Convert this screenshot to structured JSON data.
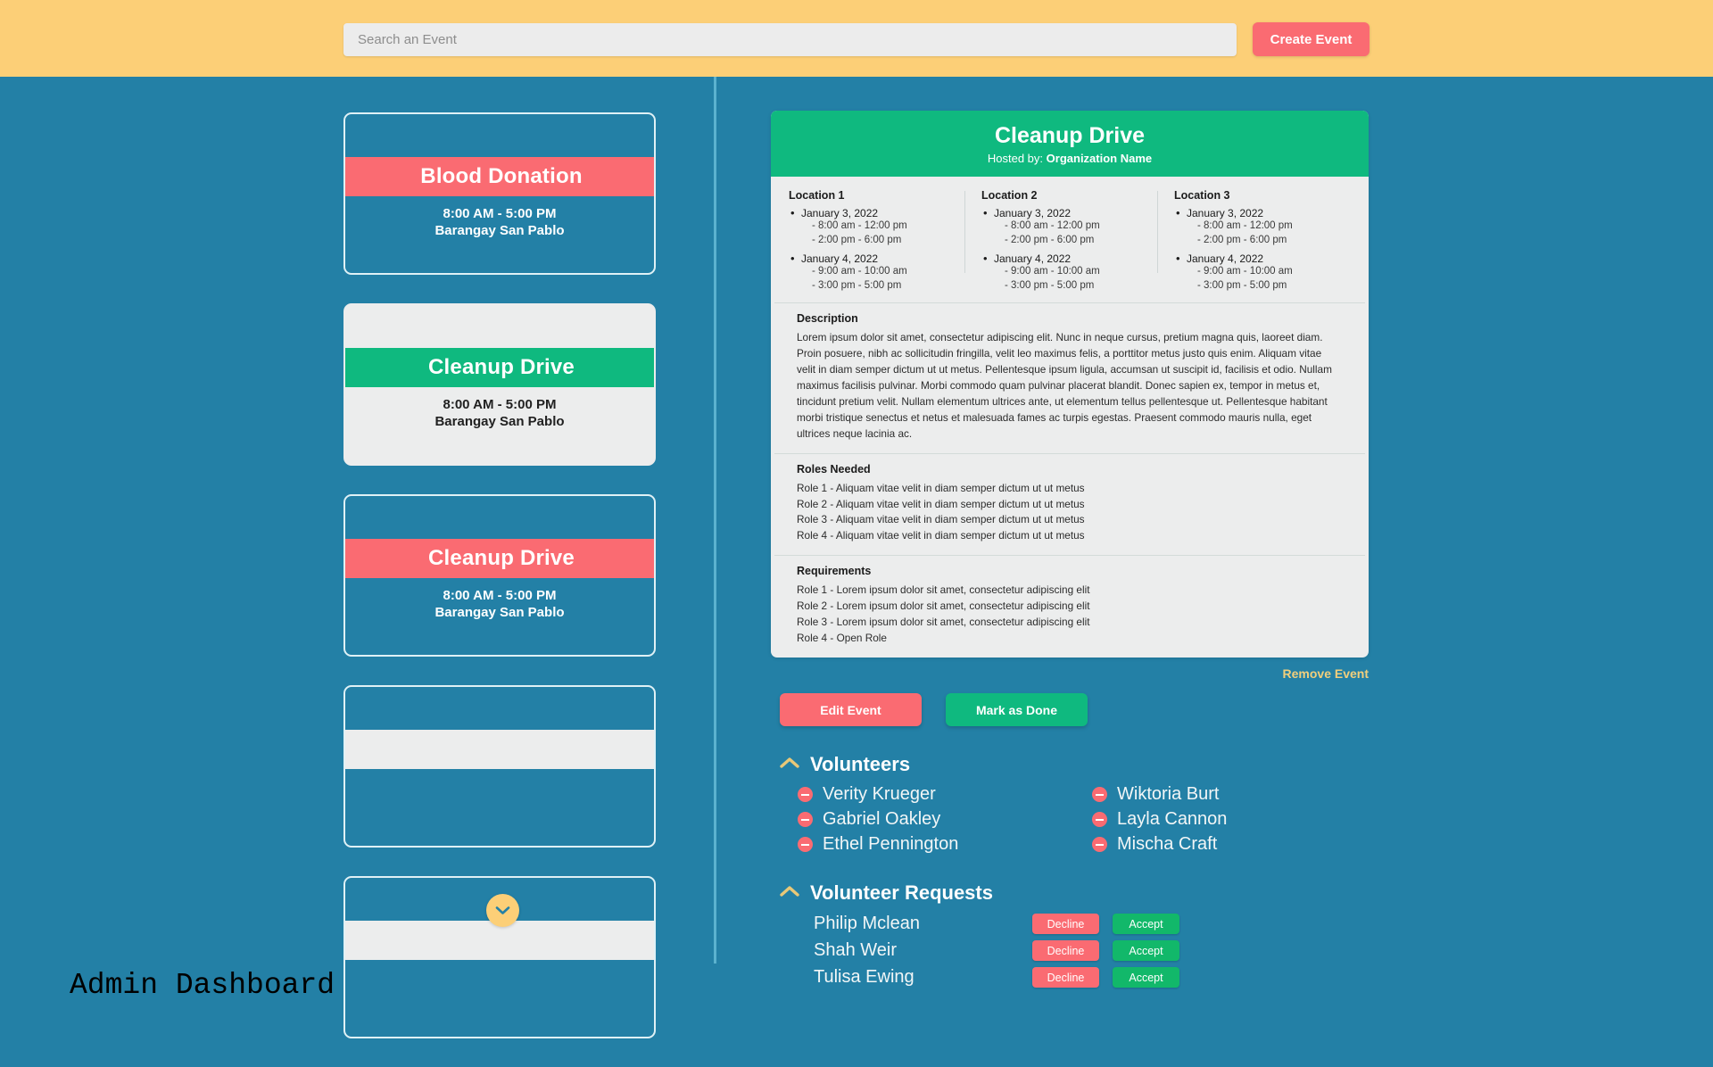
{
  "app": {
    "admin_label": "Admin Dashboard"
  },
  "topbar": {
    "search_placeholder": "Search an Event",
    "search_value": "",
    "create_button": "Create Event"
  },
  "event_list": [
    {
      "title": "Blood Donation",
      "time": "8:00 AM - 5:00 PM",
      "location": "Barangay San Pablo",
      "theme": "dark",
      "banner_color": "#fa6b72",
      "banner_variant": "red"
    },
    {
      "title": "Cleanup Drive",
      "time": "8:00 AM - 5:00 PM",
      "location": "Barangay San Pablo",
      "theme": "light",
      "banner_color": "#0fb97f",
      "banner_variant": "green"
    },
    {
      "title": "Cleanup Drive",
      "time": "8:00 AM - 5:00 PM",
      "location": "Barangay San Pablo",
      "theme": "dark",
      "banner_color": "#fa6b72",
      "banner_variant": "red"
    },
    {
      "title": "",
      "time": "",
      "location": "",
      "theme": "dark",
      "banner_color": "#eceded",
      "banner_variant": "placeholder"
    },
    {
      "title": "",
      "time": "",
      "location": "",
      "theme": "dark",
      "banner_color": "#eceded",
      "banner_variant": "placeholder"
    }
  ],
  "scroll_down_icon": "chevron-down-icon",
  "detail": {
    "title": "Cleanup Drive",
    "hosted_by_label": "Hosted by:",
    "organization": "Organization Name",
    "locations": [
      {
        "name": "Location 1",
        "days": [
          {
            "date": "January 3, 2022",
            "times": [
              "- 8:00 am - 12:00 pm",
              "- 2:00 pm - 6:00 pm"
            ]
          },
          {
            "date": "January 4, 2022",
            "times": [
              "- 9:00 am - 10:00 am",
              "- 3:00 pm - 5:00 pm"
            ]
          }
        ]
      },
      {
        "name": "Location 2",
        "days": [
          {
            "date": "January 3, 2022",
            "times": [
              "- 8:00 am - 12:00 pm",
              "- 2:00 pm - 6:00 pm"
            ]
          },
          {
            "date": "January 4, 2022",
            "times": [
              "- 9:00 am - 10:00 am",
              "- 3:00 pm - 5:00 pm"
            ]
          }
        ]
      },
      {
        "name": "Location 3",
        "days": [
          {
            "date": "January 3, 2022",
            "times": [
              "- 8:00 am - 12:00 pm",
              "- 2:00 pm - 6:00 pm"
            ]
          },
          {
            "date": "January 4, 2022",
            "times": [
              "- 9:00 am - 10:00 am",
              "- 3:00 pm - 5:00 pm"
            ]
          }
        ]
      }
    ],
    "description_label": "Description",
    "description": "Lorem ipsum dolor sit amet, consectetur adipiscing elit. Nunc in neque cursus, pretium magna quis, laoreet diam. Proin posuere, nibh ac sollicitudin fringilla, velit leo maximus felis, a porttitor metus justo quis enim. Aliquam vitae velit in diam semper dictum ut ut metus. Pellentesque ipsum ligula, accumsan ut suscipit id, facilisis et odio. Nullam maximus facilisis pulvinar. Morbi commodo quam pulvinar placerat blandit. Donec sapien ex, tempor in metus et, tincidunt pretium velit. Nullam elementum ultrices ante, ut elementum tellus pellentesque ut. Pellentesque habitant morbi tristique senectus et netus et malesuada fames ac turpis egestas. Praesent commodo mauris nulla, eget ultrices neque lacinia ac.",
    "roles_label": "Roles Needed",
    "roles": [
      "Role 1 - Aliquam vitae velit in diam semper dictum ut ut metus",
      "Role 2 - Aliquam vitae velit in diam semper dictum ut ut metus",
      "Role 3 - Aliquam vitae velit in diam semper dictum ut ut metus",
      "Role 4 - Aliquam vitae velit in diam semper dictum ut ut metus"
    ],
    "requirements_label": "Requirements",
    "requirements": [
      "Role 1 - Lorem ipsum dolor sit amet, consectetur adipiscing elit",
      "Role 2 - Lorem ipsum dolor sit amet, consectetur adipiscing elit",
      "Role 3 - Lorem ipsum dolor sit amet, consectetur adipiscing elit",
      "Role 4 - Open Role"
    ],
    "remove_link": "Remove Event",
    "edit_button": "Edit Event",
    "done_button": "Mark as Done"
  },
  "volunteers": {
    "title": "Volunteers",
    "collapse_icon": "chevron-up-icon",
    "items": [
      "Verity Krueger",
      "Wiktoria Burt",
      "Gabriel Oakley",
      "Layla Cannon",
      "Ethel Pennington",
      "Mischa Craft"
    ]
  },
  "requests": {
    "title": "Volunteer Requests",
    "collapse_icon": "chevron-up-icon",
    "decline_label": "Decline",
    "accept_label": "Accept",
    "items": [
      "Philip Mclean",
      "Shah Weir",
      "Tulisa Ewing"
    ]
  },
  "colors": {
    "background": "#2380a6",
    "topbar": "#fccf77",
    "accent_red": "#fa6b72",
    "accent_green": "#0fb97f",
    "panel_bg": "#eceded",
    "link_gold": "#f2cf7c"
  }
}
